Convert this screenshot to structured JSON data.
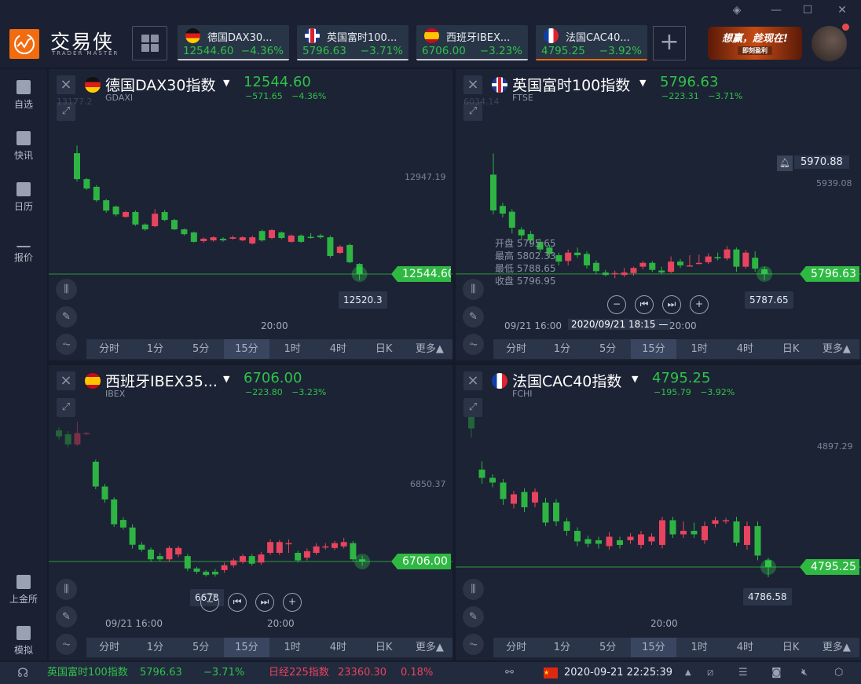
{
  "window": {
    "controls": [
      "layers-icon",
      "minimize-icon",
      "maximize-icon",
      "close-icon"
    ]
  },
  "brand": {
    "name": "交易侠",
    "sub": "TRADER MASTER"
  },
  "tabs": [
    {
      "name": "德国DAX30...",
      "price": "12544.60",
      "change": "−4.36%",
      "flag": "de"
    },
    {
      "name": "英国富时100...",
      "price": "5796.63",
      "change": "−3.71%",
      "flag": "uk"
    },
    {
      "name": "西班牙IBEX...",
      "price": "6706.00",
      "change": "−3.23%",
      "flag": "es"
    },
    {
      "name": "法国CAC40...",
      "price": "4795.25",
      "change": "−3.92%",
      "flag": "fr",
      "active": true
    }
  ],
  "ad": {
    "title": "想赢，趁现在!",
    "button": "即刻盈利"
  },
  "sidebar": [
    {
      "label": "自选"
    },
    {
      "label": "快讯"
    },
    {
      "label": "日历"
    },
    {
      "label": "报价"
    },
    {
      "label": "上金所"
    },
    {
      "label": "模拟"
    }
  ],
  "timeframes": [
    "分时",
    "1分",
    "5分",
    "15分",
    "1时",
    "4时",
    "日K",
    "更多▲"
  ],
  "selected_timeframe": "15分",
  "colors": {
    "up": "#e8445f",
    "down": "#2db443",
    "accent": "#f26b0f"
  },
  "panels": [
    {
      "name": "德国DAX30指数",
      "code": "GDAXI",
      "price": "12544.60",
      "change": "−571.65  −4.36%",
      "top_left": "13177.2",
      "axis_label": "12947.19",
      "tag": "12544.60",
      "tooltip": "12520.3",
      "time_labels": [
        "20:00"
      ],
      "ylim": [
        12280,
        13398
      ],
      "last": 12544.6,
      "candles": [
        [
          13048,
          13080,
          12930,
          12940
        ],
        [
          12940,
          12945,
          12895,
          12901
        ],
        [
          12908,
          12915,
          12845,
          12852
        ],
        [
          12852,
          12858,
          12800,
          12809
        ],
        [
          12826,
          12830,
          12785,
          12793
        ],
        [
          12783,
          12808,
          12778,
          12803
        ],
        [
          12803,
          12810,
          12745,
          12751
        ],
        [
          12751,
          12756,
          12725,
          12731
        ],
        [
          12744,
          12815,
          12740,
          12796
        ],
        [
          12803,
          12812,
          12765,
          12770
        ],
        [
          12770,
          12775,
          12728,
          12731
        ],
        [
          12731,
          12735,
          12705,
          12711
        ],
        [
          12718,
          12722,
          12675,
          12679
        ],
        [
          12682,
          12697,
          12675,
          12692
        ],
        [
          12685,
          12702,
          12680,
          12698
        ],
        [
          12692,
          12698,
          12680,
          12685
        ],
        [
          12692,
          12705,
          12688,
          12698
        ],
        [
          12685,
          12702,
          12682,
          12698
        ],
        [
          12672,
          12705,
          12668,
          12698
        ],
        [
          12724,
          12730,
          12680,
          12685
        ],
        [
          12695,
          12732,
          12690,
          12728
        ],
        [
          12718,
          12722,
          12690,
          12695
        ],
        [
          12679,
          12710,
          12675,
          12705
        ],
        [
          12705,
          12710,
          12675,
          12679
        ],
        [
          12700,
          12715,
          12692,
          12698
        ],
        [
          12705,
          12712,
          12692,
          12698
        ],
        [
          12698,
          12705,
          12612,
          12620
        ],
        [
          12633,
          12665,
          12628,
          12659
        ],
        [
          12666,
          12672,
          12590,
          12594
        ],
        [
          12587,
          12590,
          12520.3,
          12544.6
        ]
      ]
    },
    {
      "name": "英国富时100指数",
      "code": "FTSE",
      "price": "5796.63",
      "change": "−223.31  −3.71%",
      "top_left": "6034.14",
      "axis_label": "5939.08",
      "alert": "5970.88",
      "tag": "5796.63",
      "tooltip": "5787.65",
      "time_labels": [
        "09/21 16:00",
        "2020/09/21 18:15 —",
        "20:00"
      ],
      "ohlc": [
        {
          "k": "开盘",
          "v": "5795.65"
        },
        {
          "k": "最高",
          "v": "5802.33"
        },
        {
          "k": "最低",
          "v": "5788.65"
        },
        {
          "k": "收盘",
          "v": "5796.95"
        }
      ],
      "ylim": [
        5697,
        6117
      ],
      "last": 5796.63,
      "candles": [
        [
          5952,
          5985,
          5890,
          5896
        ],
        [
          5903,
          5908,
          5885,
          5891
        ],
        [
          5894,
          5898,
          5860,
          5869
        ],
        [
          5866,
          5870,
          5850,
          5857
        ],
        [
          5859,
          5864,
          5842,
          5849
        ],
        [
          5847,
          5852,
          5830,
          5835
        ],
        [
          5838,
          5842,
          5822,
          5828
        ],
        [
          5826,
          5830,
          5810,
          5816
        ],
        [
          5817,
          5835,
          5810,
          5830
        ],
        [
          5830,
          5838,
          5822,
          5826
        ],
        [
          5828,
          5832,
          5805,
          5810
        ],
        [
          5814,
          5818,
          5796,
          5801
        ],
        [
          5799,
          5803,
          5793,
          5795
        ],
        [
          5797,
          5802,
          5790,
          5798
        ],
        [
          5795,
          5806,
          5792,
          5799
        ],
        [
          5798,
          5808,
          5794,
          5806
        ],
        [
          5808,
          5817,
          5804,
          5814
        ],
        [
          5814,
          5817,
          5800,
          5803
        ],
        [
          5802,
          5808,
          5796,
          5799
        ],
        [
          5800,
          5824,
          5798,
          5816
        ],
        [
          5816,
          5820,
          5806,
          5810
        ],
        [
          5809,
          5826,
          5808,
          5810
        ],
        [
          5813,
          5827,
          5812,
          5814
        ],
        [
          5815,
          5829,
          5812,
          5824
        ],
        [
          5823,
          5830,
          5818,
          5821
        ],
        [
          5821,
          5840,
          5818,
          5835
        ],
        [
          5835,
          5838,
          5800,
          5808
        ],
        [
          5808,
          5834,
          5805,
          5830
        ],
        [
          5822,
          5832,
          5800,
          5805
        ],
        [
          5804,
          5808,
          5787.65,
          5796.63
        ]
      ]
    },
    {
      "name": "西班牙IBEX35...",
      "code": "IBEX",
      "price": "6706.00",
      "change": "−223.80  −3.23%",
      "axis_label": "6850.37",
      "tag": "6706.00",
      "tooltip": "6678",
      "time_labels": [
        "09/21 16:00",
        "20:00"
      ],
      "ylim": [
        6572,
        7070
      ],
      "last": 6706,
      "candles": [
        [
          6949,
          6955,
          6932,
          6938
        ],
        [
          6942,
          6948,
          6918,
          6923
        ],
        [
          6923,
          6965,
          6920,
          6944
        ],
        [
          6943,
          6947,
          6940,
          6944
        ],
        [
          6891,
          6895,
          6840,
          6845
        ],
        [
          6845,
          6850,
          6815,
          6821
        ],
        [
          6821,
          6825,
          6770,
          6775
        ],
        [
          6783,
          6788,
          6765,
          6769
        ],
        [
          6769,
          6775,
          6730,
          6737
        ],
        [
          6737,
          6742,
          6724,
          6728
        ],
        [
          6728,
          6732,
          6705,
          6710
        ],
        [
          6716,
          6722,
          6706,
          6710
        ],
        [
          6710,
          6735,
          6705,
          6731
        ],
        [
          6719,
          6735,
          6714,
          6731
        ],
        [
          6716,
          6720,
          6688,
          6693
        ],
        [
          6693,
          6696,
          6683,
          6687
        ],
        [
          6687,
          6690,
          6678,
          6681
        ],
        [
          6687,
          6692,
          6678,
          6682
        ],
        [
          6690,
          6704,
          6685,
          6699
        ],
        [
          6699,
          6712,
          6695,
          6708
        ],
        [
          6705,
          6720,
          6702,
          6716
        ],
        [
          6716,
          6720,
          6698,
          6702
        ],
        [
          6704,
          6724,
          6700,
          6719
        ],
        [
          6722,
          6747,
          6718,
          6742
        ],
        [
          6722,
          6746,
          6718,
          6742
        ],
        [
          6739,
          6747,
          6722,
          6740
        ],
        [
          6722,
          6726,
          6704,
          6708
        ],
        [
          6713,
          6730,
          6708,
          6725
        ],
        [
          6722,
          6740,
          6718,
          6734
        ],
        [
          6733,
          6740,
          6728,
          6734
        ],
        [
          6731,
          6744,
          6727,
          6740
        ],
        [
          6734,
          6750,
          6730,
          6742
        ],
        [
          6740,
          6744,
          6705,
          6710
        ],
        [
          6710,
          6716,
          6698,
          6706
        ]
      ]
    },
    {
      "name": "法国CAC40指数",
      "code": "FCHI",
      "price": "4795.25",
      "change": "−195.79  −3.92%",
      "axis_label": "4897.29",
      "tag": "4795.25",
      "tooltip": "4786.58",
      "time_labels": [
        "20:00"
      ],
      "ylim": [
        4738.6,
        4966.7
      ],
      "last": 4795.25,
      "candles": [
        [
          4930,
          4935,
          4905,
          4913
        ],
        [
          4878,
          4885,
          4866,
          4871
        ],
        [
          4871,
          4874,
          4863,
          4867
        ],
        [
          4867,
          4870,
          4848,
          4853
        ],
        [
          4849,
          4860,
          4845,
          4857
        ],
        [
          4859,
          4862,
          4842,
          4846
        ],
        [
          4850,
          4862,
          4846,
          4859
        ],
        [
          4850,
          4854,
          4830,
          4833
        ],
        [
          4850,
          4853,
          4830,
          4834
        ],
        [
          4834,
          4837,
          4822,
          4826
        ],
        [
          4826,
          4829,
          4813,
          4817
        ],
        [
          4819,
          4822,
          4812,
          4815
        ],
        [
          4818,
          4821,
          4811,
          4815
        ],
        [
          4813,
          4825,
          4810,
          4821
        ],
        [
          4818,
          4821,
          4811,
          4814
        ],
        [
          4818,
          4824,
          4815,
          4821
        ],
        [
          4814,
          4826,
          4811,
          4823
        ],
        [
          4817,
          4824,
          4814,
          4821
        ],
        [
          4814,
          4838,
          4811,
          4835
        ],
        [
          4835,
          4838,
          4820,
          4823
        ],
        [
          4823,
          4834,
          4820,
          4826
        ],
        [
          4826,
          4833,
          4820,
          4823
        ],
        [
          4818,
          4834,
          4815,
          4830
        ],
        [
          4832,
          4838,
          4829,
          4835
        ],
        [
          4834,
          4837,
          4832,
          4835
        ],
        [
          4834,
          4838,
          4813,
          4816
        ],
        [
          4814,
          4834,
          4810,
          4830
        ],
        [
          4830,
          4834,
          4801,
          4805
        ],
        [
          4801,
          4803,
          4786.58,
          4795.25
        ]
      ]
    }
  ],
  "status": {
    "q1_name": "英国富时100指数",
    "q1_price": "5796.63",
    "q1_change": "−3.71%",
    "q2_name": "日经225指数",
    "q2_price": "23360.30",
    "q2_change": "0.18%",
    "datetime": "2020-09-21 22:25:39"
  }
}
